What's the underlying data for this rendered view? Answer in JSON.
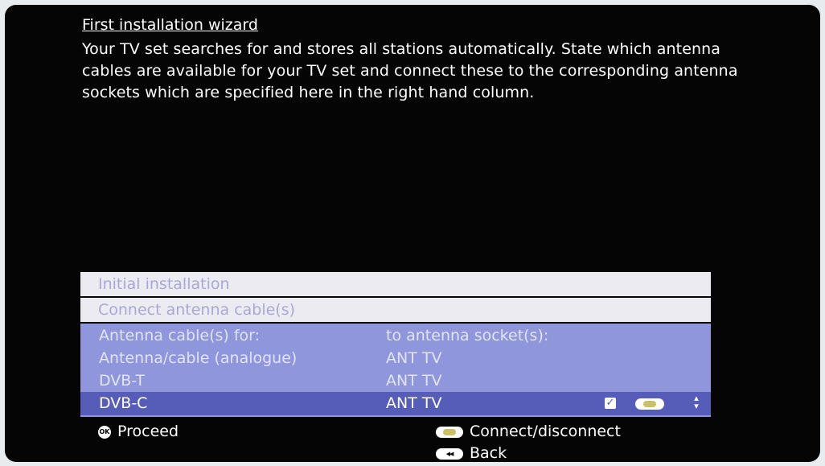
{
  "wizard": {
    "title": "First installation wizard",
    "description": "Your TV set searches for and stores all stations automatically. State which antenna cables are available for your TV set and connect these to the corresponding antenna sockets which are specified here in the right hand column."
  },
  "menu": {
    "level1": "Initial installation",
    "level2": "Connect antenna cable(s)"
  },
  "table": {
    "headers": [
      "Antenna cable(s) for:",
      "to antenna socket(s):"
    ],
    "rows": [
      {
        "source": "Antenna/cable (analogue)",
        "socket": "ANT TV"
      },
      {
        "source": "DVB-T",
        "socket": "ANT TV"
      },
      {
        "source": "DVB-C",
        "socket": "ANT TV",
        "selected": true,
        "checked": true
      }
    ]
  },
  "footer": {
    "proceed": "Proceed",
    "ok_icon_text": "OK",
    "connect": "Connect/disconnect",
    "back": "Back"
  },
  "icons": {
    "ok": "ok-button-icon",
    "yellow_key": "yellow-key-icon",
    "back_key": "back-key-icon",
    "checkbox": "checkbox-checked-icon",
    "scroll": "up-down-arrows-icon"
  },
  "colors": {
    "screen_bg": "#050506",
    "menu_bar_bg": "#ecebf2",
    "table_bg": "#8f96dc",
    "selected_row_bg": "#555db8",
    "yellow_key": "#c9c067"
  }
}
